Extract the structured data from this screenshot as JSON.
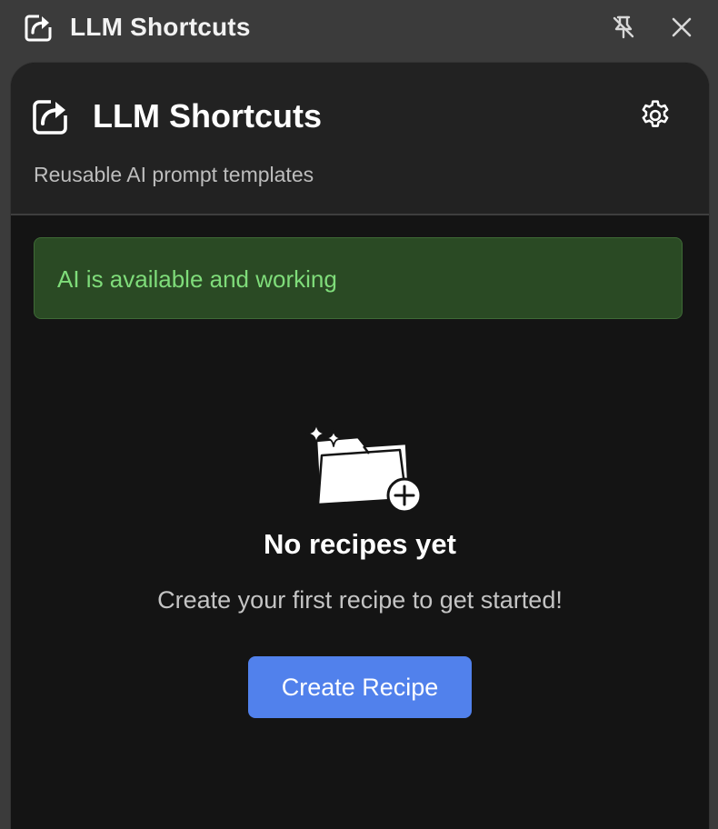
{
  "titlebar": {
    "title": "LLM Shortcuts",
    "app_icon": "share-box-icon",
    "pin_icon": "unpin-icon",
    "close_icon": "close-icon"
  },
  "header": {
    "title": "LLM Shortcuts",
    "subtitle": "Reusable AI prompt templates",
    "logo_icon": "share-box-icon",
    "settings_icon": "gear-icon"
  },
  "status": {
    "text": "AI is available and working",
    "color": "#7fdc7a",
    "background": "#2a4a24"
  },
  "empty_state": {
    "icon": "folder-sparkle-plus-icon",
    "title": "No recipes yet",
    "description": "Create your first recipe to get started!",
    "button_label": "Create Recipe"
  },
  "colors": {
    "accent": "#5181ec",
    "panel_bg": "#141414",
    "header_bg": "#222222"
  }
}
